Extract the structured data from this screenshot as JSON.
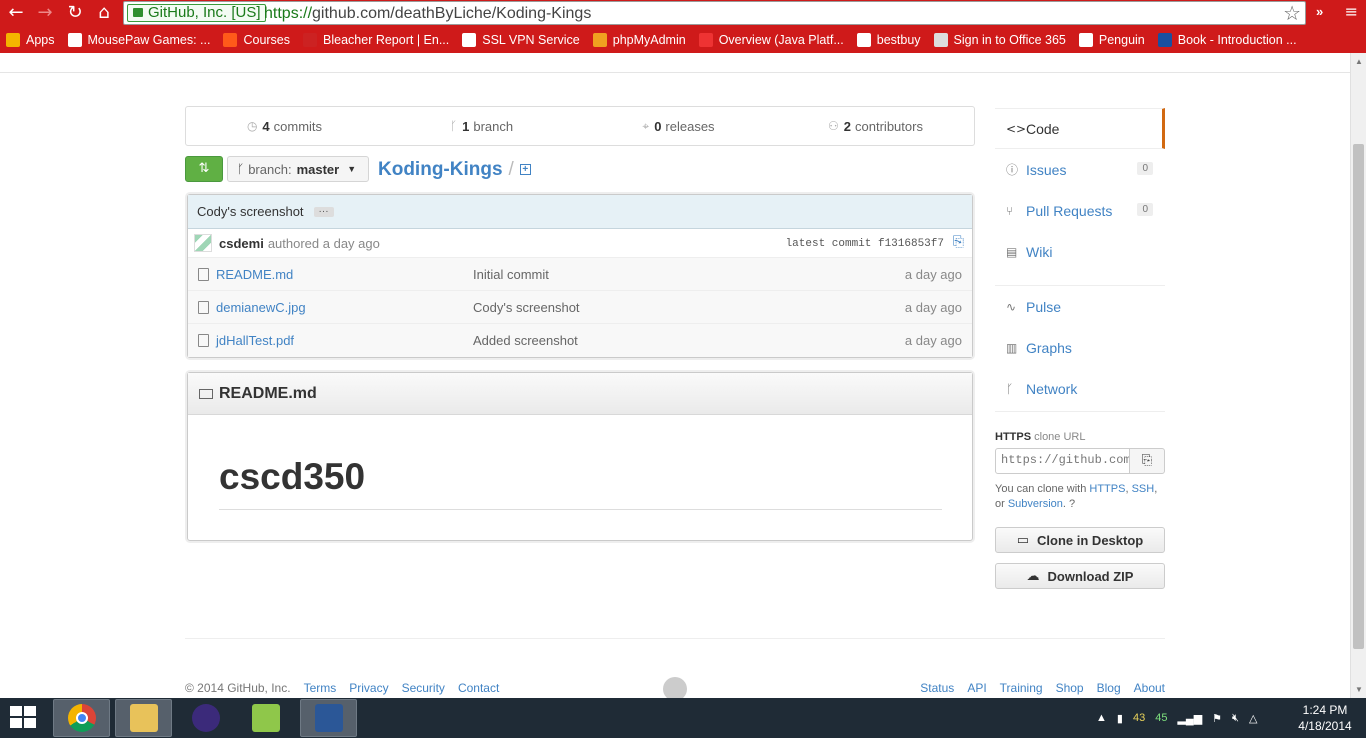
{
  "browser": {
    "ev_badge": "GitHub, Inc. [US]",
    "url_scheme": "https://",
    "url_rest": "github.com/deathByLiche/Koding-Kings",
    "ext_label": "»"
  },
  "bookmarks": [
    {
      "label": "Apps",
      "color": "#f4b400"
    },
    {
      "label": "MousePaw Games: ...",
      "color": "#ffffff"
    },
    {
      "label": "Courses",
      "color": "#ff5a1a"
    },
    {
      "label": "Bleacher Report | En...",
      "color": "#c22"
    },
    {
      "label": "SSL VPN Service",
      "color": "#ffffff"
    },
    {
      "label": "phpMyAdmin",
      "color": "#f0a020"
    },
    {
      "label": "Overview (Java Platf...",
      "color": "#e33"
    },
    {
      "label": "bestbuy",
      "color": "#ffffff"
    },
    {
      "label": "Sign in to Office 365",
      "color": "#ddd"
    },
    {
      "label": "Penguin",
      "color": "#ffffff"
    },
    {
      "label": "Book - Introduction ...",
      "color": "#1a4fa0"
    }
  ],
  "summary": {
    "commits_count": "4",
    "commits_label": "commits",
    "branch_count": "1",
    "branch_label": "branch",
    "releases_count": "0",
    "releases_label": "releases",
    "contributors_count": "2",
    "contributors_label": "contributors"
  },
  "repo": {
    "branch_prefix": "branch:",
    "branch_name": "master",
    "name": "Koding-Kings",
    "separator": "/"
  },
  "commit": {
    "message": "Cody's screenshot",
    "more": "···",
    "author": "csdemi",
    "authored": "authored a day ago",
    "latest": "latest commit f1316853f7"
  },
  "files": [
    {
      "name": "README.md",
      "message": "Initial commit",
      "age": "a day ago"
    },
    {
      "name": "demianewC.jpg",
      "message": "Cody's screenshot",
      "age": "a day ago"
    },
    {
      "name": "jdHallTest.pdf",
      "message": "Added screenshot",
      "age": "a day ago"
    }
  ],
  "readme": {
    "title": "README.md",
    "heading": "cscd350"
  },
  "sidebar": {
    "items": [
      {
        "label": "Code",
        "icon": "code-icon"
      },
      {
        "label": "Issues",
        "count": "0",
        "icon": "issues-icon"
      },
      {
        "label": "Pull Requests",
        "count": "0",
        "icon": "pull-request-icon"
      },
      {
        "label": "Wiki",
        "icon": "wiki-icon"
      },
      {
        "label": "Pulse",
        "icon": "pulse-icon"
      },
      {
        "label": "Graphs",
        "icon": "graph-icon"
      },
      {
        "label": "Network",
        "icon": "network-icon"
      }
    ],
    "clone_proto": "HTTPS",
    "clone_label": "clone URL",
    "clone_value": "https://github.com/deathByLiche/Koding-Kings.git",
    "help_prefix": "You can clone with",
    "help_https": "HTTPS",
    "help_comma": ",",
    "help_ssh": "SSH",
    "help_or": ", or",
    "help_svn": "Subversion",
    "help_end": ".",
    "clone_desktop": "Clone in Desktop",
    "download_zip": "Download ZIP"
  },
  "footer": {
    "copyright": "© 2014 GitHub, Inc.",
    "left_links": [
      "Terms",
      "Privacy",
      "Security",
      "Contact"
    ],
    "right_links": [
      "Status",
      "API",
      "Training",
      "Shop",
      "Blog",
      "About"
    ]
  },
  "taskbar": {
    "tray_num1": "43",
    "tray_num2": "45",
    "time": "1:24 PM",
    "date": "4/18/2014"
  },
  "colors": {
    "chrome_red": "#cf1a1a",
    "link_blue": "#4183c4",
    "compare_green": "#60b044",
    "active_tab_orange": "#d26911"
  }
}
